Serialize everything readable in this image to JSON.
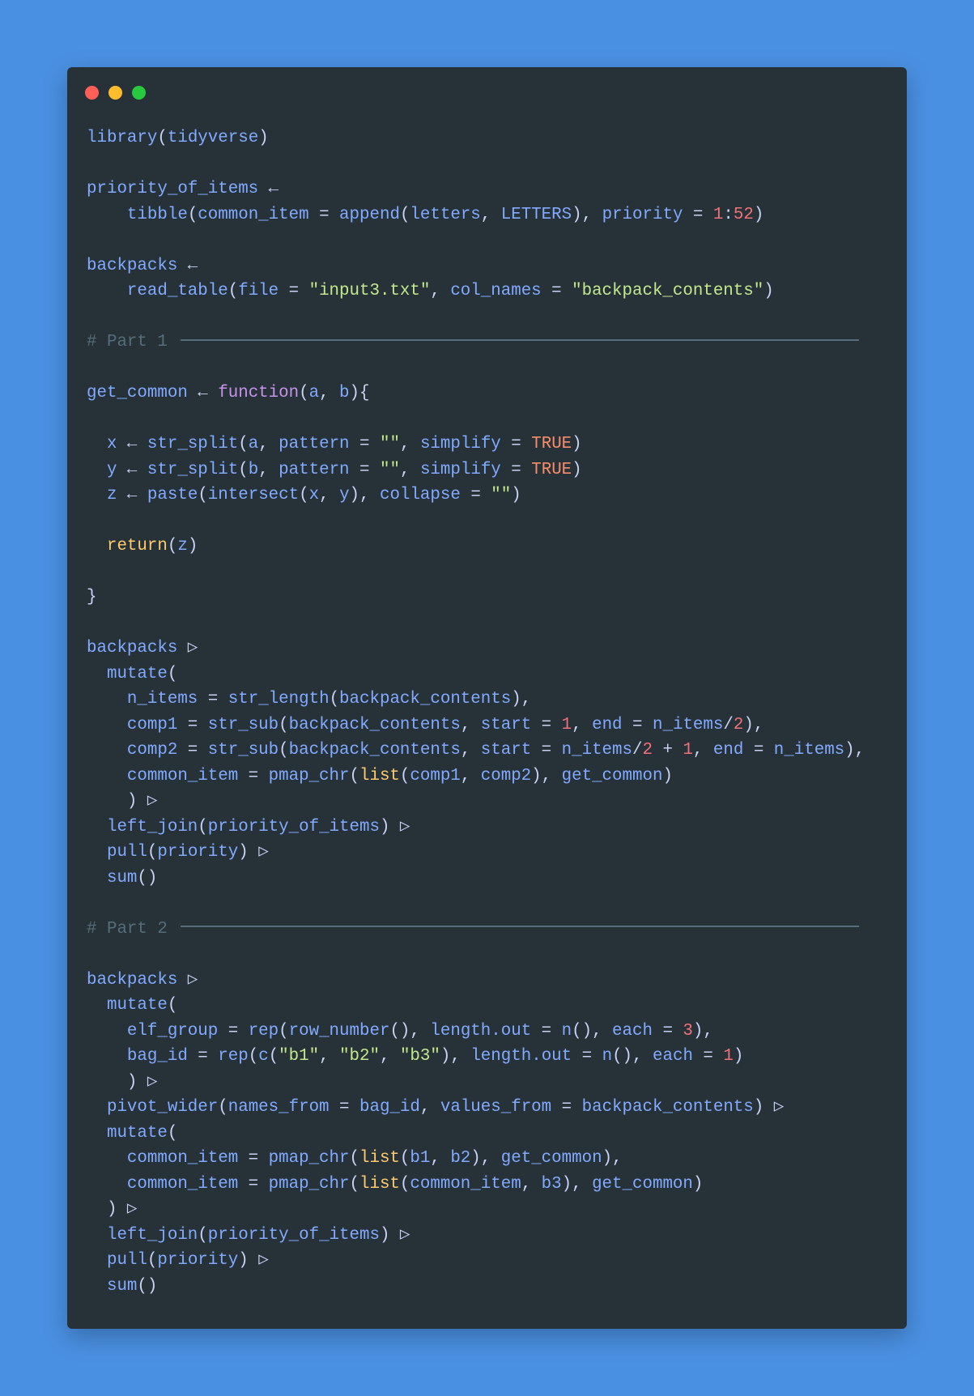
{
  "window": {
    "controls": [
      "close",
      "minimize",
      "maximize"
    ],
    "colors": {
      "background": "#4a90e2",
      "editor": "#263238"
    }
  },
  "code": {
    "language": "R",
    "lines": [
      [
        [
          "plain",
          "library"
        ],
        [
          "punct",
          "("
        ],
        [
          "plain",
          "tidyverse"
        ],
        [
          "punct",
          ")"
        ]
      ],
      [],
      [
        [
          "plain",
          "priority_of_items"
        ],
        [
          "op",
          " ← "
        ]
      ],
      [
        [
          "plain",
          "    tibble"
        ],
        [
          "punct",
          "("
        ],
        [
          "plain",
          "common_item"
        ],
        [
          "op",
          " = "
        ],
        [
          "plain",
          "append"
        ],
        [
          "punct",
          "("
        ],
        [
          "plain",
          "letters"
        ],
        [
          "punct",
          ", "
        ],
        [
          "plain",
          "LETTERS"
        ],
        [
          "punct",
          "), "
        ],
        [
          "plain",
          "priority"
        ],
        [
          "op",
          " = "
        ],
        [
          "num",
          "1"
        ],
        [
          "op",
          ":"
        ],
        [
          "num",
          "52"
        ],
        [
          "punct",
          ")"
        ]
      ],
      [],
      [
        [
          "plain",
          "backpacks"
        ],
        [
          "op",
          " ← "
        ]
      ],
      [
        [
          "plain",
          "    read_table"
        ],
        [
          "punct",
          "("
        ],
        [
          "plain",
          "file"
        ],
        [
          "op",
          " = "
        ],
        [
          "str",
          "\"input3.txt\""
        ],
        [
          "punct",
          ", "
        ],
        [
          "plain",
          "col_names"
        ],
        [
          "op",
          " = "
        ],
        [
          "str",
          "\"backpack_contents\""
        ],
        [
          "punct",
          ")"
        ]
      ],
      [],
      [
        [
          "comment",
          "# Part 1 "
        ],
        [
          "rule",
          ""
        ]
      ],
      [],
      [
        [
          "plain",
          "get_common"
        ],
        [
          "op",
          " ← "
        ],
        [
          "kw",
          "function"
        ],
        [
          "punct",
          "("
        ],
        [
          "plain",
          "a"
        ],
        [
          "punct",
          ", "
        ],
        [
          "plain",
          "b"
        ],
        [
          "punct",
          "){"
        ]
      ],
      [],
      [
        [
          "plain",
          "  x"
        ],
        [
          "op",
          " ← "
        ],
        [
          "plain",
          "str_split"
        ],
        [
          "punct",
          "("
        ],
        [
          "plain",
          "a"
        ],
        [
          "punct",
          ", "
        ],
        [
          "plain",
          "pattern"
        ],
        [
          "op",
          " = "
        ],
        [
          "str",
          "\"\""
        ],
        [
          "punct",
          ", "
        ],
        [
          "plain",
          "simplify"
        ],
        [
          "op",
          " = "
        ],
        [
          "bool",
          "TRUE"
        ],
        [
          "punct",
          ")"
        ]
      ],
      [
        [
          "plain",
          "  y"
        ],
        [
          "op",
          " ← "
        ],
        [
          "plain",
          "str_split"
        ],
        [
          "punct",
          "("
        ],
        [
          "plain",
          "b"
        ],
        [
          "punct",
          ", "
        ],
        [
          "plain",
          "pattern"
        ],
        [
          "op",
          " = "
        ],
        [
          "str",
          "\"\""
        ],
        [
          "punct",
          ", "
        ],
        [
          "plain",
          "simplify"
        ],
        [
          "op",
          " = "
        ],
        [
          "bool",
          "TRUE"
        ],
        [
          "punct",
          ")"
        ]
      ],
      [
        [
          "plain",
          "  z"
        ],
        [
          "op",
          " ← "
        ],
        [
          "plain",
          "paste"
        ],
        [
          "punct",
          "("
        ],
        [
          "plain",
          "intersect"
        ],
        [
          "punct",
          "("
        ],
        [
          "plain",
          "x"
        ],
        [
          "punct",
          ", "
        ],
        [
          "plain",
          "y"
        ],
        [
          "punct",
          "), "
        ],
        [
          "plain",
          "collapse"
        ],
        [
          "op",
          " = "
        ],
        [
          "str",
          "\"\""
        ],
        [
          "punct",
          ")"
        ]
      ],
      [],
      [
        [
          "ret",
          "  return"
        ],
        [
          "punct",
          "("
        ],
        [
          "plain",
          "z"
        ],
        [
          "punct",
          ")"
        ]
      ],
      [],
      [
        [
          "punct",
          "}"
        ]
      ],
      [],
      [
        [
          "plain",
          "backpacks"
        ],
        [
          "op",
          " ▷"
        ]
      ],
      [
        [
          "plain",
          "  mutate"
        ],
        [
          "punct",
          "("
        ]
      ],
      [
        [
          "plain",
          "    n_items"
        ],
        [
          "op",
          " = "
        ],
        [
          "plain",
          "str_length"
        ],
        [
          "punct",
          "("
        ],
        [
          "plain",
          "backpack_contents"
        ],
        [
          "punct",
          "),"
        ]
      ],
      [
        [
          "plain",
          "    comp1"
        ],
        [
          "op",
          " = "
        ],
        [
          "plain",
          "str_sub"
        ],
        [
          "punct",
          "("
        ],
        [
          "plain",
          "backpack_contents"
        ],
        [
          "punct",
          ", "
        ],
        [
          "plain",
          "start"
        ],
        [
          "op",
          " = "
        ],
        [
          "num",
          "1"
        ],
        [
          "punct",
          ", "
        ],
        [
          "plain",
          "end"
        ],
        [
          "op",
          " = "
        ],
        [
          "plain",
          "n_items"
        ],
        [
          "op",
          "/"
        ],
        [
          "num",
          "2"
        ],
        [
          "punct",
          "),"
        ]
      ],
      [
        [
          "plain",
          "    comp2"
        ],
        [
          "op",
          " = "
        ],
        [
          "plain",
          "str_sub"
        ],
        [
          "punct",
          "("
        ],
        [
          "plain",
          "backpack_contents"
        ],
        [
          "punct",
          ", "
        ],
        [
          "plain",
          "start"
        ],
        [
          "op",
          " = "
        ],
        [
          "plain",
          "n_items"
        ],
        [
          "op",
          "/"
        ],
        [
          "num",
          "2"
        ],
        [
          "op",
          " + "
        ],
        [
          "num",
          "1"
        ],
        [
          "punct",
          ", "
        ],
        [
          "plain",
          "end"
        ],
        [
          "op",
          " = "
        ],
        [
          "plain",
          "n_items"
        ],
        [
          "punct",
          "),"
        ]
      ],
      [
        [
          "plain",
          "    common_item"
        ],
        [
          "op",
          " = "
        ],
        [
          "plain",
          "pmap_chr"
        ],
        [
          "punct",
          "("
        ],
        [
          "list",
          "list"
        ],
        [
          "punct",
          "("
        ],
        [
          "plain",
          "comp1"
        ],
        [
          "punct",
          ", "
        ],
        [
          "plain",
          "comp2"
        ],
        [
          "punct",
          "), "
        ],
        [
          "plain",
          "get_common"
        ],
        [
          "punct",
          ")"
        ]
      ],
      [
        [
          "punct",
          "    ) "
        ],
        [
          "op",
          "▷"
        ]
      ],
      [
        [
          "plain",
          "  left_join"
        ],
        [
          "punct",
          "("
        ],
        [
          "plain",
          "priority_of_items"
        ],
        [
          "punct",
          ") "
        ],
        [
          "op",
          "▷"
        ]
      ],
      [
        [
          "plain",
          "  pull"
        ],
        [
          "punct",
          "("
        ],
        [
          "plain",
          "priority"
        ],
        [
          "punct",
          ") "
        ],
        [
          "op",
          "▷"
        ]
      ],
      [
        [
          "plain",
          "  sum"
        ],
        [
          "punct",
          "()"
        ]
      ],
      [],
      [
        [
          "comment",
          "# Part 2 "
        ],
        [
          "rule",
          ""
        ]
      ],
      [],
      [
        [
          "plain",
          "backpacks"
        ],
        [
          "op",
          " ▷"
        ]
      ],
      [
        [
          "plain",
          "  mutate"
        ],
        [
          "punct",
          "("
        ]
      ],
      [
        [
          "plain",
          "    elf_group"
        ],
        [
          "op",
          " = "
        ],
        [
          "plain",
          "rep"
        ],
        [
          "punct",
          "("
        ],
        [
          "plain",
          "row_number"
        ],
        [
          "punct",
          "(), "
        ],
        [
          "plain",
          "length.out"
        ],
        [
          "op",
          " = "
        ],
        [
          "plain",
          "n"
        ],
        [
          "punct",
          "(), "
        ],
        [
          "plain",
          "each"
        ],
        [
          "op",
          " = "
        ],
        [
          "num",
          "3"
        ],
        [
          "punct",
          "),"
        ]
      ],
      [
        [
          "plain",
          "    bag_id"
        ],
        [
          "op",
          " = "
        ],
        [
          "plain",
          "rep"
        ],
        [
          "punct",
          "("
        ],
        [
          "plain",
          "c"
        ],
        [
          "punct",
          "("
        ],
        [
          "str",
          "\"b1\""
        ],
        [
          "punct",
          ", "
        ],
        [
          "str",
          "\"b2\""
        ],
        [
          "punct",
          ", "
        ],
        [
          "str",
          "\"b3\""
        ],
        [
          "punct",
          "), "
        ],
        [
          "plain",
          "length.out"
        ],
        [
          "op",
          " = "
        ],
        [
          "plain",
          "n"
        ],
        [
          "punct",
          "(), "
        ],
        [
          "plain",
          "each"
        ],
        [
          "op",
          " = "
        ],
        [
          "num",
          "1"
        ],
        [
          "punct",
          ")"
        ]
      ],
      [
        [
          "punct",
          "    ) "
        ],
        [
          "op",
          "▷"
        ]
      ],
      [
        [
          "plain",
          "  pivot_wider"
        ],
        [
          "punct",
          "("
        ],
        [
          "plain",
          "names_from"
        ],
        [
          "op",
          " = "
        ],
        [
          "plain",
          "bag_id"
        ],
        [
          "punct",
          ", "
        ],
        [
          "plain",
          "values_from"
        ],
        [
          "op",
          " = "
        ],
        [
          "plain",
          "backpack_contents"
        ],
        [
          "punct",
          ") "
        ],
        [
          "op",
          "▷"
        ]
      ],
      [
        [
          "plain",
          "  mutate"
        ],
        [
          "punct",
          "("
        ]
      ],
      [
        [
          "plain",
          "    common_item"
        ],
        [
          "op",
          " = "
        ],
        [
          "plain",
          "pmap_chr"
        ],
        [
          "punct",
          "("
        ],
        [
          "list",
          "list"
        ],
        [
          "punct",
          "("
        ],
        [
          "plain",
          "b1"
        ],
        [
          "punct",
          ", "
        ],
        [
          "plain",
          "b2"
        ],
        [
          "punct",
          "), "
        ],
        [
          "plain",
          "get_common"
        ],
        [
          "punct",
          "),"
        ]
      ],
      [
        [
          "plain",
          "    common_item"
        ],
        [
          "op",
          " = "
        ],
        [
          "plain",
          "pmap_chr"
        ],
        [
          "punct",
          "("
        ],
        [
          "list",
          "list"
        ],
        [
          "punct",
          "("
        ],
        [
          "plain",
          "common_item"
        ],
        [
          "punct",
          ", "
        ],
        [
          "plain",
          "b3"
        ],
        [
          "punct",
          "), "
        ],
        [
          "plain",
          "get_common"
        ],
        [
          "punct",
          ")"
        ]
      ],
      [
        [
          "punct",
          "  ) "
        ],
        [
          "op",
          "▷"
        ]
      ],
      [
        [
          "plain",
          "  left_join"
        ],
        [
          "punct",
          "("
        ],
        [
          "plain",
          "priority_of_items"
        ],
        [
          "punct",
          ") "
        ],
        [
          "op",
          "▷"
        ]
      ],
      [
        [
          "plain",
          "  pull"
        ],
        [
          "punct",
          "("
        ],
        [
          "plain",
          "priority"
        ],
        [
          "punct",
          ") "
        ],
        [
          "op",
          "▷"
        ]
      ],
      [
        [
          "plain",
          "  sum"
        ],
        [
          "punct",
          "()"
        ]
      ]
    ]
  }
}
